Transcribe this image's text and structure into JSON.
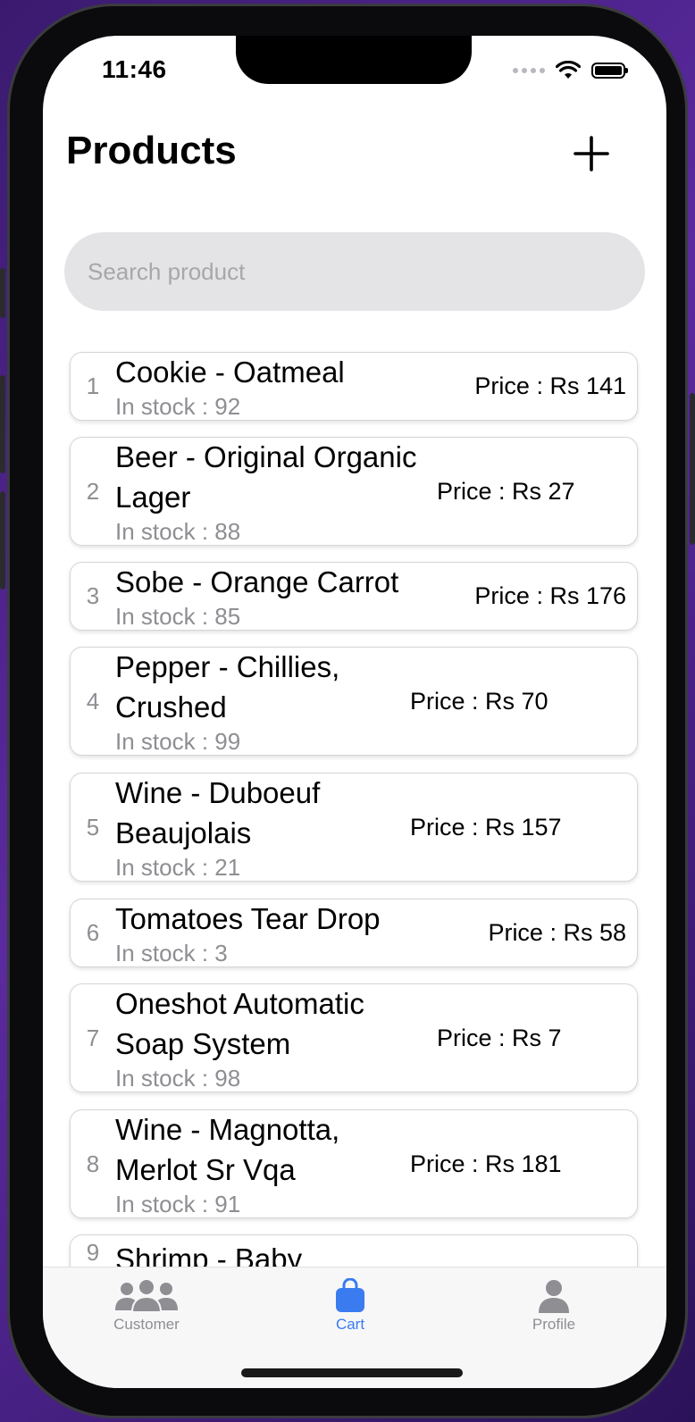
{
  "status_bar": {
    "time": "11:46"
  },
  "header": {
    "title": "Products"
  },
  "search": {
    "placeholder": "Search product"
  },
  "products": [
    {
      "index": "1",
      "name": "Cookie - Oatmeal",
      "stock": "In stock : 92",
      "price": "Price : Rs 141"
    },
    {
      "index": "2",
      "name": "Beer - Original Organic Lager",
      "stock": "In stock : 88",
      "price": "Price : Rs 27"
    },
    {
      "index": "3",
      "name": "Sobe - Orange Carrot",
      "stock": "In stock : 85",
      "price": "Price : Rs 176"
    },
    {
      "index": "4",
      "name": "Pepper - Chillies, Crushed",
      "stock": "In stock : 99",
      "price": "Price : Rs 70"
    },
    {
      "index": "5",
      "name": "Wine - Duboeuf Beaujolais",
      "stock": "In stock : 21",
      "price": "Price : Rs 157"
    },
    {
      "index": "6",
      "name": "Tomatoes Tear Drop",
      "stock": "In stock : 3",
      "price": "Price : Rs 58"
    },
    {
      "index": "7",
      "name": "Oneshot Automatic Soap System",
      "stock": "In stock : 98",
      "price": "Price : Rs 7"
    },
    {
      "index": "8",
      "name": "Wine - Magnotta, Merlot Sr Vqa",
      "stock": "In stock : 91",
      "price": "Price : Rs 181"
    },
    {
      "index": "9",
      "name": "Shrimp - Baby",
      "stock": "",
      "price": ""
    }
  ],
  "tab_bar": {
    "tabs": [
      {
        "label": "Customer",
        "icon": "people-icon",
        "active": false
      },
      {
        "label": "Cart",
        "icon": "bag-icon",
        "active": true
      },
      {
        "label": "Profile",
        "icon": "person-icon",
        "active": false
      }
    ]
  },
  "colors": {
    "accent": "#3a7bf0",
    "inactive": "#8e8e93",
    "muted_text": "#8e8e93"
  }
}
